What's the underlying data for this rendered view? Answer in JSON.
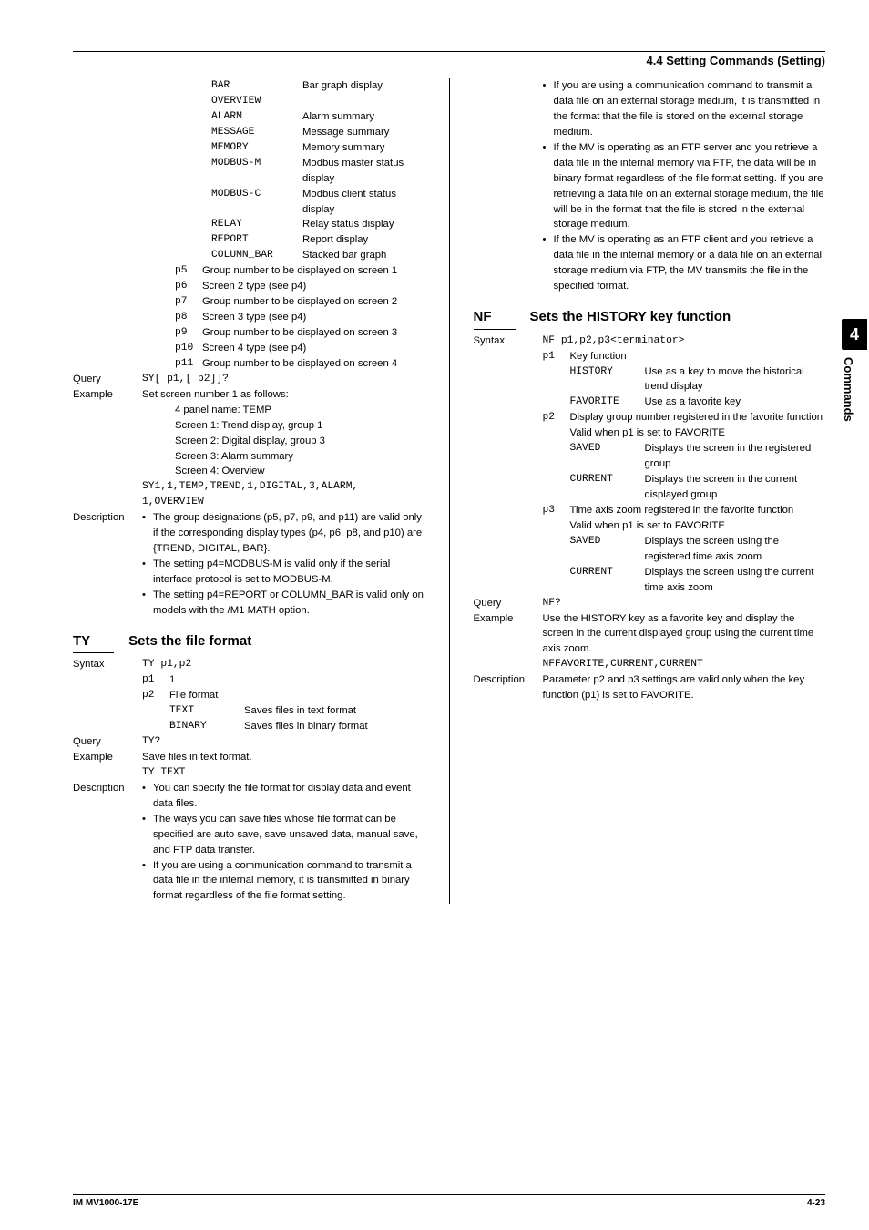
{
  "header": {
    "section": "4.4  Setting Commands (Setting)"
  },
  "tab": {
    "num": "4",
    "label": "Commands"
  },
  "footer": {
    "left": "IM MV1000-17E",
    "right": "4-23"
  },
  "left": {
    "display_opts": [
      {
        "val": "BAR",
        "desc": "Bar graph display"
      },
      {
        "val": "OVERVIEW",
        "desc": ""
      },
      {
        "val": "ALARM",
        "desc": "Alarm summary"
      },
      {
        "val": "MESSAGE",
        "desc": "Message summary"
      },
      {
        "val": "MEMORY",
        "desc": "Memory summary"
      },
      {
        "val": "MODBUS-M",
        "desc": "Modbus master status display"
      },
      {
        "val": "MODBUS-C",
        "desc": "Modbus client status display"
      },
      {
        "val": "RELAY",
        "desc": "Relay status display"
      },
      {
        "val": "REPORT",
        "desc": "Report display"
      },
      {
        "val": "COLUMN_BAR",
        "desc": "Stacked bar graph"
      }
    ],
    "params": [
      {
        "k": "p5",
        "t": "Group number to be displayed on screen 1"
      },
      {
        "k": "p6",
        "t": "Screen 2 type (see p4)"
      },
      {
        "k": "p7",
        "t": "Group number to be displayed on screen 2"
      },
      {
        "k": "p8",
        "t": "Screen 3 type (see p4)"
      },
      {
        "k": "p9",
        "t": "Group number to be displayed on screen 3"
      },
      {
        "k": "p10",
        "t": "Screen 4 type (see p4)"
      },
      {
        "k": "p11",
        "t": "Group number to be displayed on screen 4"
      }
    ],
    "query_l": "Query",
    "query_v": "SY[ p1,[ p2]]?",
    "example_l": "Example",
    "example_intro": "Set screen number 1 as follows:",
    "example_lines": [
      "4 panel name: TEMP",
      "Screen 1: Trend display, group 1",
      "Screen 2: Digital display, group 3",
      "Screen 3: Alarm summary",
      "Screen 4: Overview"
    ],
    "example_code1": "SY1,1,TEMP,TREND,1,DIGITAL,3,ALARM,",
    "example_code2": "1,OVERVIEW",
    "desc_l": "Description",
    "desc_bullets": [
      "The group designations (p5, p7, p9, and p11) are valid only if the corresponding display types (p4, p6, p8, and p10) are {TREND, DIGITAL, BAR}.",
      "The setting p4=MODBUS-M is valid only if the serial interface protocol is set to MODBUS-M.",
      "The setting p4=REPORT or COLUMN_BAR is valid only on models with the /M1 MATH option."
    ],
    "ty": {
      "code": "TY",
      "title": "Sets the file format",
      "syntax_l": "Syntax",
      "syntax_v": "TY p1,p2",
      "p1_k": "p1",
      "p1_v": "1",
      "p2_k": "p2",
      "p2_v": "File format",
      "fmt": [
        {
          "v": "TEXT",
          "d": "Saves files in text format"
        },
        {
          "v": "BINARY",
          "d": "Saves files in binary format"
        }
      ],
      "query_l": "Query",
      "query_v": "TY?",
      "example_l": "Example",
      "example_t": "Save files in text format.",
      "example_c": "TY TEXT",
      "desc_l": "Description",
      "desc_bullets": [
        "You can specify the file format for display data and event data files.",
        "The ways you can save files whose file format can be specified are auto save, save unsaved data, manual save, and FTP data transfer.",
        "If you are using a communication command to transmit a data file in the internal memory, it is transmitted in binary format regardless of the file format setting."
      ]
    }
  },
  "right": {
    "cont_bullets": [
      "If you are using a communication command to transmit a data file on an external storage medium, it is transmitted in the format that the file is stored on the external storage medium.",
      "If the MV is operating as an FTP server and you retrieve a data file in the internal memory via FTP, the data will be in binary format regardless of the file format setting. If you are retrieving a data file on an external storage medium, the file will be in the format that the file is stored in the external storage medium.",
      "If the MV is operating as an FTP client and you retrieve a data file in the internal memory or a data file on an external storage medium via FTP, the MV transmits the file in the specified format."
    ],
    "nf": {
      "code": "NF",
      "title": "Sets the HISTORY key function",
      "syntax_l": "Syntax",
      "syntax_v": "NF p1,p2,p3<terminator>",
      "p1_k": "p1",
      "p1_t": "Key function",
      "p1_opts": [
        {
          "v": "HISTORY",
          "d": "Use as a key to move the historical trend display"
        },
        {
          "v": "FAVORITE",
          "d": "Use as a favorite key"
        }
      ],
      "p2_k": "p2",
      "p2_t": "Display group number registered in the favorite function",
      "p2_valid": "Valid when p1 is set to FAVORITE",
      "p2_opts": [
        {
          "v": "SAVED",
          "d": "Displays the screen in the registered group"
        },
        {
          "v": "CURRENT",
          "d": "Displays the screen in the current displayed group"
        }
      ],
      "p3_k": "p3",
      "p3_t": "Time axis zoom registered in the favorite function",
      "p3_valid": "Valid when p1 is set to FAVORITE",
      "p3_opts": [
        {
          "v": "SAVED",
          "d": "Displays the screen using the registered time axis zoom"
        },
        {
          "v": "CURRENT",
          "d": "Displays the screen using the current time axis zoom"
        }
      ],
      "query_l": "Query",
      "query_v": "NF?",
      "example_l": "Example",
      "example_t": "Use the HISTORY key as a favorite key and display the screen in the current displayed group using the current time axis zoom.",
      "example_c": "NFFAVORITE,CURRENT,CURRENT",
      "desc_l": "Description",
      "desc_t": "Parameter p2 and p3 settings are valid only when the key function (p1) is set to FAVORITE."
    }
  }
}
